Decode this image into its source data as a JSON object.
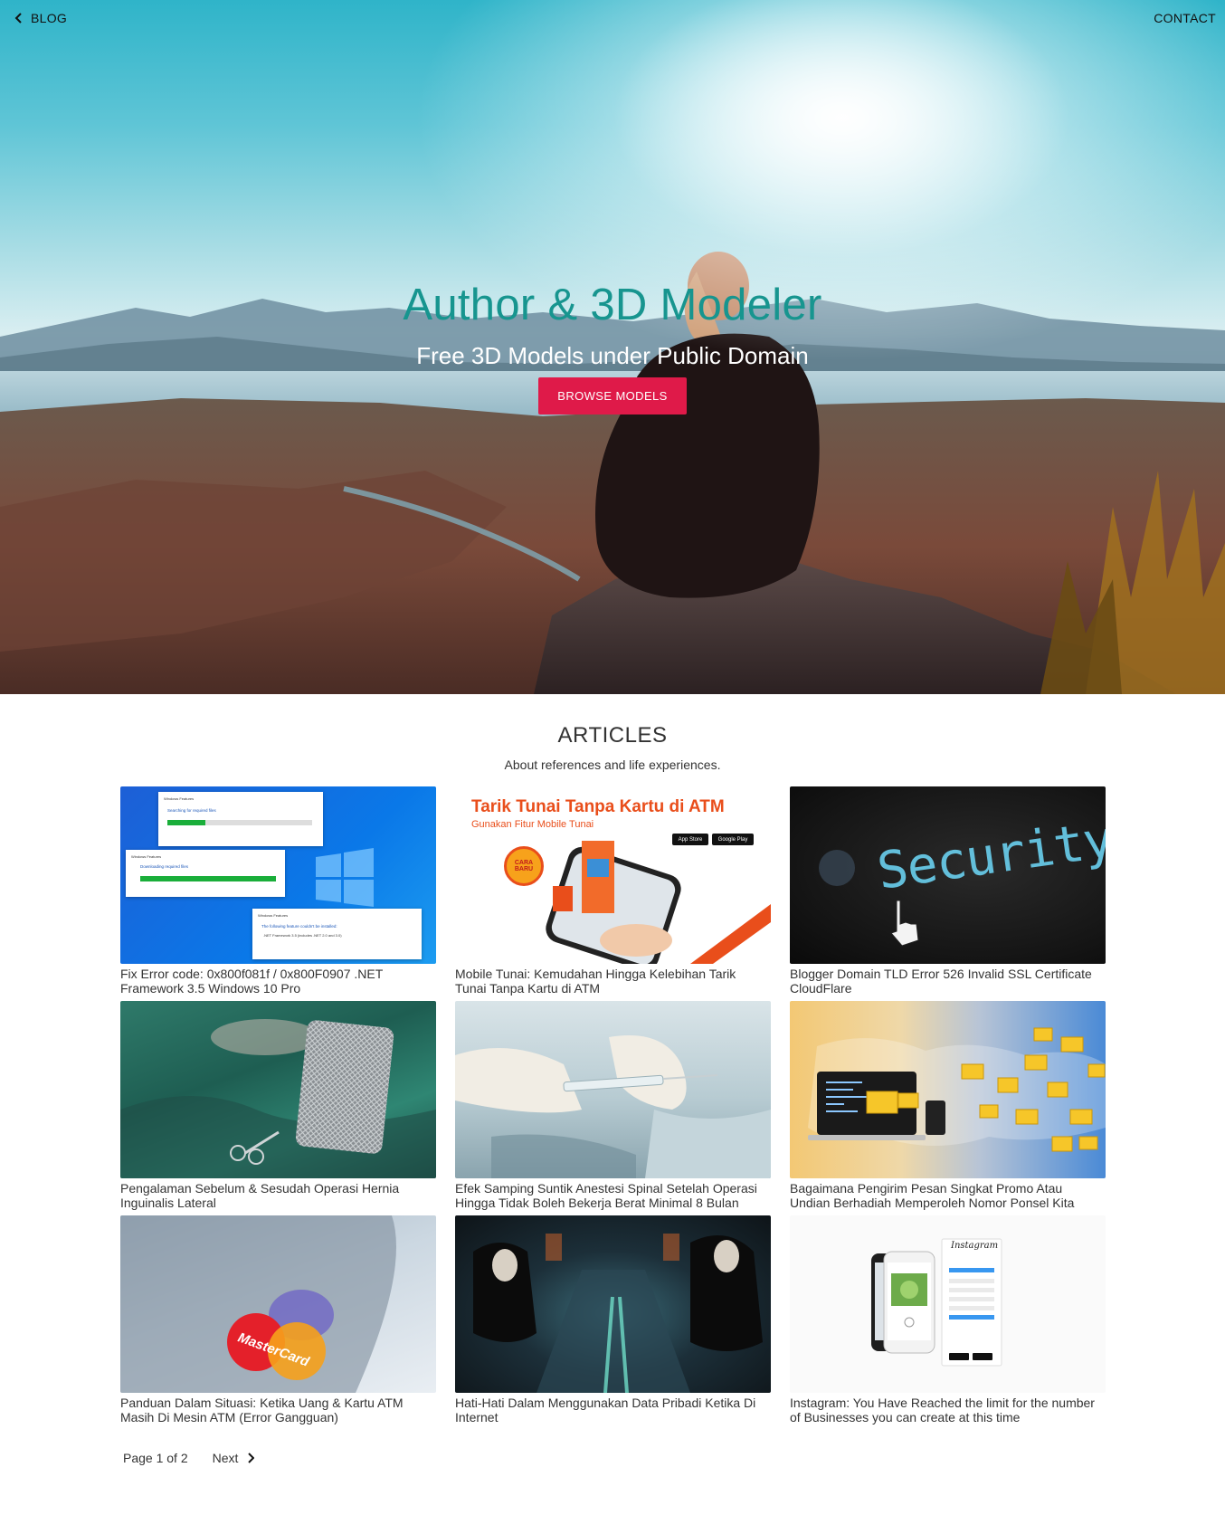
{
  "nav": {
    "blog_label": "BLOG",
    "contact_label": "CONTACT"
  },
  "hero": {
    "title": "Author & 3D Modeler",
    "subtitle": "Free 3D Models under Public Domain",
    "cta_label": "BROWSE MODELS",
    "title_color": "#17958f",
    "cta_color": "#df1a49"
  },
  "articles": {
    "heading": "ARTICLES",
    "subheading": "About references and life experiences.",
    "items": [
      {
        "title": "Fix Error code: 0x800f081f / 0x800F0907 .NET Framework 3.5 Windows 10 Pro",
        "image": "windows-features-dialogs"
      },
      {
        "title": "Mobile Tunai: Kemudahan Hingga Kelebihan Tarik Tunai Tanpa Kartu di ATM",
        "image": "mobile-tunai-banner"
      },
      {
        "title": "Blogger Domain TLD Error 526 Invalid SSL Certificate CloudFlare",
        "image": "security-screen"
      },
      {
        "title": "Pengalaman Sebelum & Sesudah Operasi Hernia Inguinalis Lateral",
        "image": "surgery-mesh"
      },
      {
        "title": "Efek Samping Suntik Anestesi Spinal Setelah Operasi Hingga Tidak Boleh Bekerja Berat Minimal 8 Bulan",
        "image": "syringe-gloves"
      },
      {
        "title": "Bagaimana Pengirim Pesan Singkat Promo Atau Undian Berhadiah Memperoleh Nomor Ponsel Kita",
        "image": "envelopes-world-map"
      },
      {
        "title": "Panduan Dalam Situasi: Ketika Uang & Kartu ATM Masih Di Mesin ATM (Error Gangguan)",
        "image": "mastercard-card"
      },
      {
        "title": "Hati-Hati Dalam Menggunakan Data Pribadi Ketika Di Internet",
        "image": "masked-hackers-train"
      },
      {
        "title": "Instagram: You Have Reached the limit for the number of Businesses you can create at this time",
        "image": "instagram-phones"
      }
    ]
  },
  "thumb_text": {
    "atm_heading": "Tarik Tunai Tanpa Kartu di ATM",
    "atm_sub": "Gunakan Fitur Mobile Tunai",
    "atm_badge": "CARA BARU",
    "app_store": "App Store",
    "google_play": "Google Play",
    "security_word": "Security",
    "card_brand": "MasterCard",
    "instagram_word": "Instagram",
    "win_search": "Searching for required files",
    "win_download": "Downloading required files",
    "win_error": "The following feature couldn't be installed:",
    "win_feature": ".NET Framework 3.5 (includes .NET 2.0 and 3.0)",
    "win_title": "Windows Features"
  },
  "pagination": {
    "page_label": "Page 1 of 2",
    "next_label": "Next"
  }
}
